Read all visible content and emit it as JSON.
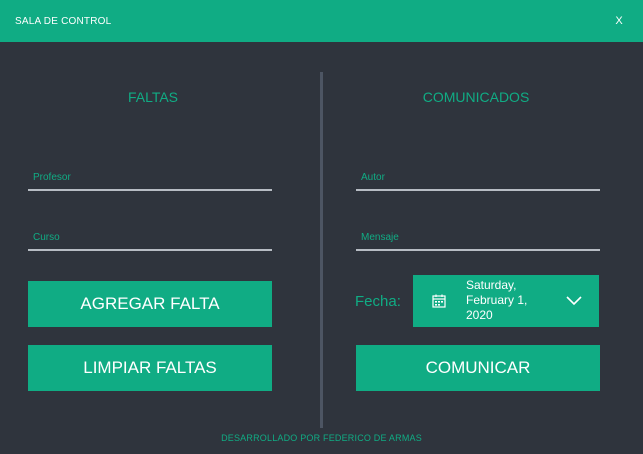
{
  "window": {
    "title": "SALA DE CONTROL",
    "close_label": "X"
  },
  "faltas": {
    "title": "FALTAS",
    "profesor_placeholder": "Profesor",
    "curso_placeholder": "Curso",
    "add_button": "AGREGAR FALTA",
    "clear_button": "LIMPIAR FALTAS"
  },
  "comunicados": {
    "title": "COMUNICADOS",
    "autor_placeholder": "Autor",
    "mensaje_placeholder": "Mensaje",
    "fecha_label": "Fecha:",
    "date_line1": "Saturday,",
    "date_line2": "February 1,",
    "date_line3": "2020",
    "send_button": "COMUNICAR"
  },
  "footer": "DESARROLLADO POR FEDERICO DE ARMAS",
  "colors": {
    "accent": "#10ac84",
    "background": "#2f343d",
    "divider": "#4d5563",
    "underline": "#b7bcc4"
  },
  "icons": {
    "calendar": "calendar-icon",
    "dropdown": "chevron-down-icon"
  }
}
